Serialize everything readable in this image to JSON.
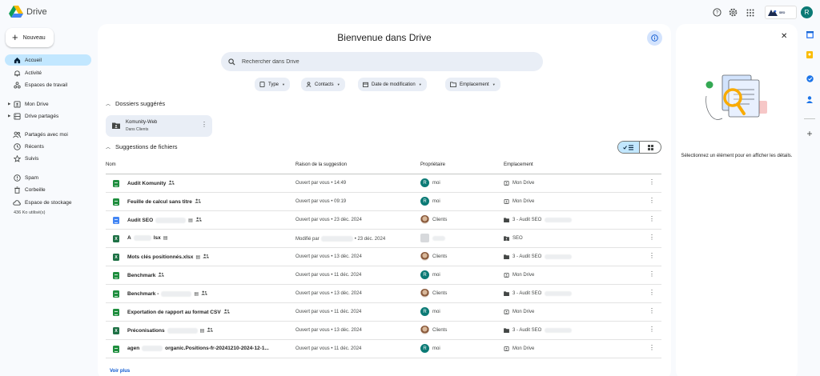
{
  "app": {
    "name": "Drive"
  },
  "topbar": {
    "icons": [
      "help-icon",
      "settings-icon",
      "apps-grid-icon"
    ],
    "org_badge_text": "SEO",
    "account_initial": "R"
  },
  "sidebar": {
    "new_label": "Nouveau",
    "items": [
      {
        "label": "Accueil",
        "icon": "home-icon",
        "active": true
      },
      {
        "label": "Activité",
        "icon": "bell-icon"
      },
      {
        "label": "Espaces de travail",
        "icon": "workspaces-icon"
      },
      {
        "label": "Mon Drive",
        "icon": "my-drive-icon",
        "expandable": true
      },
      {
        "label": "Drive partagés",
        "icon": "shared-drives-icon",
        "expandable": true
      },
      {
        "label": "Partagés avec moi",
        "icon": "people-icon"
      },
      {
        "label": "Récents",
        "icon": "clock-icon"
      },
      {
        "label": "Suivis",
        "icon": "star-icon"
      },
      {
        "label": "Spam",
        "icon": "spam-icon"
      },
      {
        "label": "Corbeille",
        "icon": "trash-icon"
      },
      {
        "label": "Espace de stockage",
        "icon": "cloud-icon"
      }
    ],
    "storage_text": "436 Ko utilisé(s)"
  },
  "main": {
    "welcome_title": "Bienvenue dans Drive",
    "search_placeholder": "Rechercher dans Drive",
    "filters": [
      "Type",
      "Contacts",
      "Date de modification",
      "Emplacement"
    ],
    "suggested_folders_title": "Dossiers suggérés",
    "folder": {
      "name": "Komunity-Web",
      "subtitle": "Dans Clients"
    },
    "suggested_files_title": "Suggestions de fichiers",
    "columns": {
      "name": "Nom",
      "reason": "Raison de la suggestion",
      "owner": "Propriétaire",
      "location": "Emplacement"
    },
    "files": [
      {
        "name": "Audit Komunity",
        "type": "sheet",
        "shared": true,
        "reason": "Ouvert par vous • 14:49",
        "owner": "moi",
        "owner_kind": "initial",
        "location": "Mon Drive",
        "loc_kind": "drive"
      },
      {
        "name": "Feuille de calcul sans titre",
        "type": "sheet",
        "shared": true,
        "reason": "Ouvert par vous • 09:19",
        "owner": "moi",
        "owner_kind": "initial",
        "location": "Mon Drive",
        "loc_kind": "drive"
      },
      {
        "name": "Audit SEO",
        "type": "doc",
        "shared": true,
        "redacted": true,
        "reason": "Ouvert par vous • 23 déc. 2024",
        "owner": "Clients",
        "owner_kind": "photo",
        "location": "3 - Audit SEO",
        "loc_kind": "folder",
        "loc_redacted": true
      },
      {
        "name": "A",
        "name_tail": "lsx",
        "type": "xls",
        "redacted_mid": true,
        "reason": "Modifié par",
        "reason_tail": "• 23 déc. 2024",
        "reason_redacted": true,
        "owner": "",
        "owner_kind": "shared",
        "location": "SEO",
        "loc_kind": "shared-folder"
      },
      {
        "name": "Mots clés positionnés.xlsx",
        "type": "xls",
        "shared": true,
        "reason": "Ouvert par vous • 13 déc. 2024",
        "owner": "Clients",
        "owner_kind": "photo",
        "location": "3 - Audit SEO",
        "loc_kind": "folder",
        "loc_redacted": true
      },
      {
        "name": "Benchmark",
        "type": "sheet",
        "shared": true,
        "reason": "Ouvert par vous • 11 déc. 2024",
        "owner": "moi",
        "owner_kind": "initial",
        "location": "Mon Drive",
        "loc_kind": "drive"
      },
      {
        "name": "Benchmark -",
        "type": "sheet",
        "shared": true,
        "redacted": true,
        "reason": "Ouvert par vous • 13 déc. 2024",
        "owner": "Clients",
        "owner_kind": "photo",
        "location": "3 - Audit SEO",
        "loc_kind": "folder",
        "loc_redacted": true
      },
      {
        "name": "Exportation de rapport au format CSV",
        "type": "sheet",
        "shared": true,
        "reason": "Ouvert par vous • 11 déc. 2024",
        "owner": "moi",
        "owner_kind": "initial",
        "location": "Mon Drive",
        "loc_kind": "drive"
      },
      {
        "name": "Préconisations",
        "type": "xls",
        "shared": true,
        "redacted": true,
        "reason": "Ouvert par vous • 13 déc. 2024",
        "owner": "Clients",
        "owner_kind": "photo",
        "location": "3 - Audit SEO",
        "loc_kind": "folder",
        "loc_redacted": true
      },
      {
        "name": "agen",
        "name_tail": "organic.Positions-fr-20241210-2024-12-1...",
        "type": "sheet",
        "redacted_mid": true,
        "reason": "Ouvert par vous • 11 déc. 2024",
        "owner": "moi",
        "owner_kind": "initial",
        "location": "Mon Drive",
        "loc_kind": "drive"
      }
    ],
    "see_more": "Voir plus"
  },
  "details": {
    "message": "Sélectionnez un élément pour en afficher les détails."
  },
  "colors": {
    "accent": "#0b57d0",
    "active_nav": "#c2e7ff",
    "surface": "#e9eef6",
    "avatar": "#0b7a75"
  }
}
